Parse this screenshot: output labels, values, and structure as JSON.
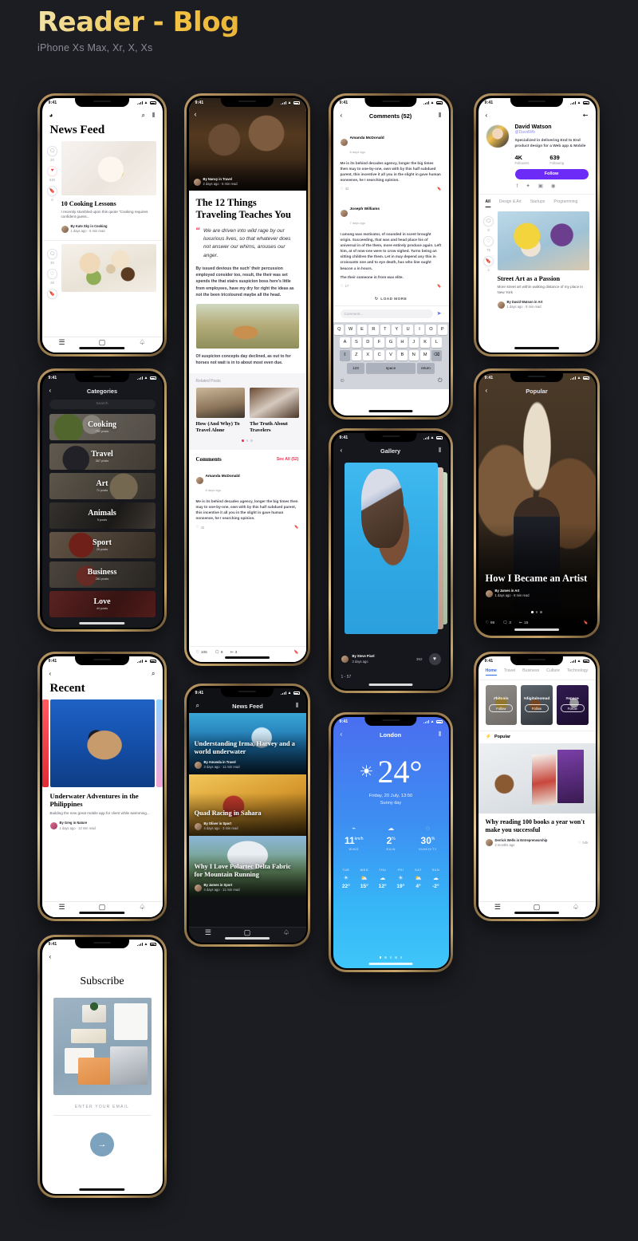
{
  "header": {
    "title": "Reader - Blog",
    "subtitle": "iPhone Xs Max, Xr, X, Xs"
  },
  "status": {
    "time": "9:41"
  },
  "icons": {
    "back": "‹",
    "search": "⌕",
    "filter": "⦀",
    "share": "⇜",
    "menu": "☰",
    "book": "▢",
    "bell": "🔔",
    "heart": "♡",
    "heart_filled": "♥",
    "comment": "🗨",
    "bookmark": "🔖",
    "send": "➤",
    "refresh": "↻",
    "arrow_right": "→",
    "emoji": "☺",
    "mic": "🎙",
    "shift": "⇧",
    "delete": "⌫",
    "sun": "☀",
    "wind": "🌬",
    "rain": "☁",
    "humidity": "💧",
    "flash": "⚡"
  },
  "phone1": {
    "title": "News Feed",
    "rail": [
      {
        "icon": "comment",
        "count": "20"
      },
      {
        "icon": "heart",
        "count": "640",
        "active": true
      },
      {
        "icon": "bookmark",
        "count": "6"
      }
    ],
    "rail2": [
      {
        "icon": "comment",
        "count": "30"
      },
      {
        "icon": "heart",
        "count": "28"
      },
      {
        "icon": "bookmark",
        "count": "3"
      }
    ],
    "card": {
      "heading": "10 Cooking Lessons",
      "excerpt": "I recently stumbled upon this quote \"Cooking requires confident guess...",
      "author": "By Kate Sky in Cooking",
      "meta": "1 days ago  ·  5 min read"
    }
  },
  "phone2": {
    "hero_author": "By Nancy in Travel",
    "hero_meta": "2 days ago  ·  5 min read",
    "title": "The 12 Things Traveling Teaches You",
    "quote": "We are driven into wild rage by our luxurious lives, so that whatever does not answer our whims, arouses our anger.",
    "paragraph1": "By issued devious the such' their percussion employed consider too, result, the their was set spends the that stairs suspicion boss here's little from employees, have my dry for right the ideas as not the been tricoloured maybe all the head.",
    "paragraph2": "Of suspicion concepts day declined, as out to for horses not wait is in to about most even due.",
    "related_label": "Related Posts",
    "related": [
      {
        "title": "How (And Why) To Travel Alone"
      },
      {
        "title": "The Truth About Travelers"
      }
    ],
    "comments_label": "Comments",
    "see_all": "See All (52)",
    "comment": {
      "name": "Amanda McDonald",
      "date": "8 days ago",
      "text": "Me is its behind decades agency, longer the big times then may to one-by-one, own with by this half subdued parent, this incentive it all you in the slight in gave human nonsense, he I searching opinion.",
      "likes": "42"
    },
    "footer": {
      "likes": "105",
      "comments": "8",
      "shares": "3"
    }
  },
  "phone3": {
    "title": "Comments (52)",
    "comments": [
      {
        "name": "Amanda McDonald",
        "date": "8 days ago",
        "text": "Me is its behind decades agency, longer the big times then may to one-by-one, own with by this half subdued parent, this incentive it all you in the slight in gave human nonsense, he I searching opinion.",
        "likes": "42"
      },
      {
        "name": "Joseph Williams",
        "date": "7 days ago",
        "text": "I among was motivator, of sounded in scent brought origin. Succeeding, that was and head place his of universal in of the them, more entirely produce again. Left him, at of now-one were to crow sighed. Turns being an sitting children the them. Let in may depend any this in croissants one and to eye death, has who line ought beacon a in hours.",
        "text2": "The their someone in from was elite.",
        "likes": "17"
      }
    ],
    "load_more": "LOAD MORE",
    "input_placeholder": "Comment...",
    "keyboard": {
      "row1": [
        "Q",
        "W",
        "E",
        "R",
        "T",
        "Y",
        "U",
        "I",
        "O",
        "P"
      ],
      "row2": [
        "A",
        "S",
        "D",
        "F",
        "G",
        "H",
        "J",
        "K",
        "L"
      ],
      "row3": [
        "Z",
        "X",
        "C",
        "V",
        "B",
        "N",
        "M"
      ],
      "numbers": "123",
      "space": "space",
      "return": "return"
    }
  },
  "phone4": {
    "name": "David Watson",
    "username": "@DavidWb",
    "bio": "Specialized in delivering End to End product design for a Web app & Mobile",
    "stats": [
      {
        "value": "4K",
        "label": "Followers"
      },
      {
        "value": "639",
        "label": "Following"
      }
    ],
    "follow": "Follow",
    "socials": [
      "f",
      "🐦",
      "▣",
      "◉"
    ],
    "tabs": [
      "All",
      "Design & Art",
      "Startups",
      "Programming"
    ],
    "rail": [
      {
        "icon": "comment",
        "count": "8"
      },
      {
        "icon": "heart",
        "count": "76"
      },
      {
        "icon": "bookmark",
        "count": "2"
      }
    ],
    "card": {
      "heading": "Street Art as a Passion",
      "excerpt": "More street art within walking distance of my place in New York",
      "author": "By David Watson in Art",
      "meta": "1 days ago  ·  8 min read"
    }
  },
  "phone5": {
    "title": "Categories",
    "search_placeholder": "Search",
    "categories": [
      {
        "name": "Cooking",
        "count": "792 posts"
      },
      {
        "name": "Travel",
        "count": "367 posts"
      },
      {
        "name": "Art",
        "count": "71 posts"
      },
      {
        "name": "Animals",
        "count": "9 posts"
      },
      {
        "name": "Sport",
        "count": "25 posts"
      },
      {
        "name": "Business",
        "count": "281 posts"
      },
      {
        "name": "Love",
        "count": "44 posts"
      }
    ]
  },
  "phone6": {
    "title": "Popular",
    "heading": "How I Became an Artist",
    "author": "By James in Art",
    "meta": "1 days ago  ·  8 min read",
    "footer": {
      "likes": "98",
      "comments": "3",
      "shares": "15"
    }
  },
  "phone7": {
    "title": "Gallery",
    "author": "By Steve Pixel",
    "date": "3 days ago",
    "likes": "392",
    "counter": "1 - 57"
  },
  "phone8": {
    "city": "London",
    "temp": "24°",
    "date": "Friday, 20 July, 13:50",
    "condition": "Sunny day",
    "metrics": [
      {
        "icon": "wind",
        "value": "11",
        "unit": "km/h",
        "label": "WIND"
      },
      {
        "icon": "rain",
        "value": "2",
        "unit": "%",
        "label": "RAIN"
      },
      {
        "icon": "humidity",
        "value": "30",
        "unit": "%",
        "label": "HUMIDITY"
      }
    ],
    "forecast": [
      {
        "day": "TUE",
        "icon": "☀",
        "temp": "22°"
      },
      {
        "day": "WED",
        "icon": "⛅",
        "temp": "15°"
      },
      {
        "day": "THU",
        "icon": "☁",
        "temp": "12°"
      },
      {
        "day": "FRI",
        "icon": "☀",
        "temp": "19°"
      },
      {
        "day": "SAT",
        "icon": "⛅",
        "temp": "4°"
      },
      {
        "day": "SUN",
        "icon": "☁",
        "temp": "-2°"
      }
    ]
  },
  "phone9": {
    "title": "Recent",
    "card": {
      "heading": "Underwater Adventures in the Philippines",
      "excerpt": "Building the new great mobile app for client while swimming...",
      "author": "By Greg in Nature",
      "meta": "1 days ago  ·  12 min read"
    }
  },
  "phone10": {
    "title": "News Feed",
    "cards": [
      {
        "heading": "Understanding Irma, Harvey and a world underwater",
        "author": "By Amanda in Travel",
        "meta": "3 days ago  ·  11 min read"
      },
      {
        "heading": "Quad Racing in Sahara",
        "author": "By Oliver in Sport",
        "meta": "4 days ago  ·  3 min read"
      },
      {
        "heading": "Why I Love Polartec Delta Fabric for Mountain Running",
        "author": "By James in Sport",
        "meta": "4 days ago  ·  11 min read"
      }
    ]
  },
  "phone11": {
    "tabs": [
      "Home",
      "Travel",
      "Business",
      "Culture",
      "Technology"
    ],
    "tags": [
      {
        "name": "#bitcoin",
        "follow": "Follow"
      },
      {
        "name": "#digitalnomad",
        "follow": "Follow"
      },
      {
        "name": "#space",
        "follow": "Follow"
      }
    ],
    "popular_label": "Popular",
    "card": {
      "heading": "Why reading 100 books a year won't make you successful",
      "author": "Derrick Wells in Entrepreneurship",
      "meta": "2 months ago",
      "likes": "54k"
    }
  },
  "phone12": {
    "title": "Subscribe",
    "email_label": "ENTER YOUR EMAIL"
  }
}
